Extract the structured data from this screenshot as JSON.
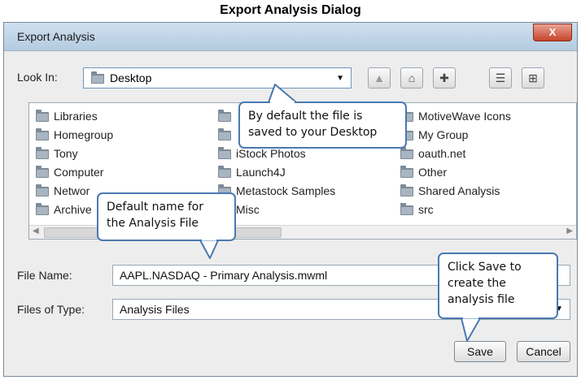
{
  "caption": "Export Analysis Dialog",
  "dialog": {
    "title": "Export Analysis",
    "close_glyph": "X",
    "look_in_label": "Look In:",
    "look_in_value": "Desktop",
    "toolbar_icons": [
      "up-folder-icon",
      "home-icon",
      "new-folder-icon",
      "list-view-icon",
      "details-view-icon"
    ]
  },
  "files": {
    "column1": [
      "Libraries",
      "Homegroup",
      "Tony",
      "Computer",
      "Networ",
      "Archive"
    ],
    "column2": [
      "",
      "",
      "iStock Photos",
      "Launch4J",
      "Metastock Samples",
      "Misc"
    ],
    "column3": [
      "MotiveWave Icons",
      "My Group",
      "oauth.net",
      "Other",
      "Shared Analysis",
      "src"
    ]
  },
  "form": {
    "file_name_label": "File Name:",
    "file_name_value": "AAPL.NASDAQ - Primary Analysis.mwml",
    "files_of_type_label": "Files of Type:",
    "files_of_type_value": "Analysis Files"
  },
  "buttons": {
    "save": "Save",
    "cancel": "Cancel"
  },
  "callouts": {
    "desktop": "By default the file is\nsaved to your Desktop",
    "name": "Default name for\nthe Analysis File",
    "save": "Click Save to\ncreate the\nanalysis file"
  },
  "colors": {
    "callout_border": "#4a79b0",
    "titlebar": "#b4cbe0",
    "close_button": "#c7442b"
  }
}
